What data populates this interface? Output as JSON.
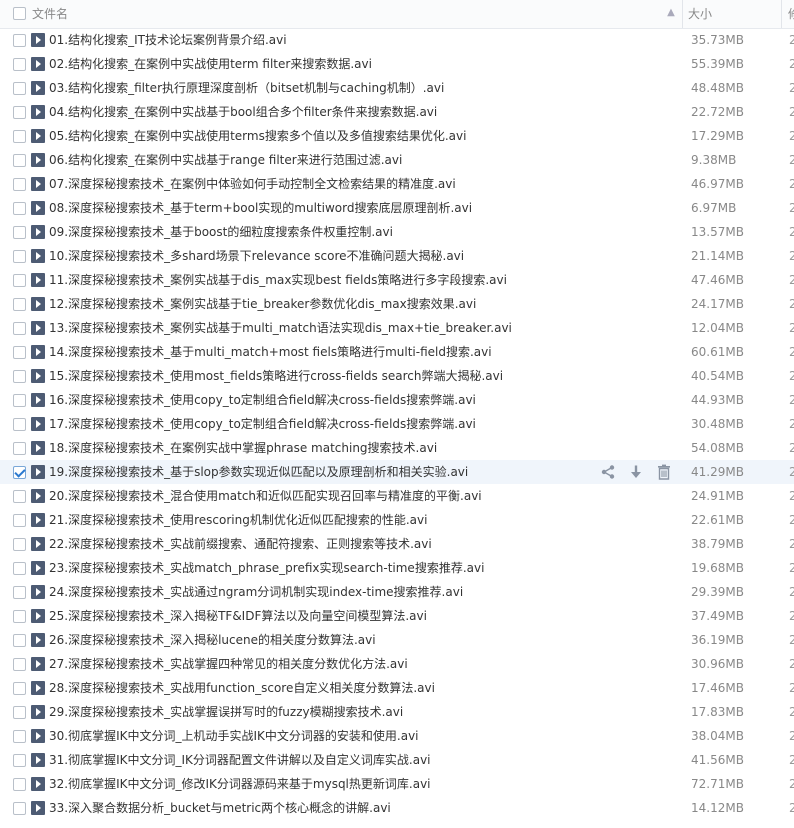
{
  "header": {
    "name_label": "文件名",
    "size_label": "大小",
    "extra_label": "修"
  },
  "icons": {
    "sort": "sort-arrow-icon",
    "file": "video-file-icon",
    "share": "share-icon",
    "download": "download-icon",
    "delete": "delete-icon"
  },
  "files": [
    {
      "name": "01.结构化搜索_IT技术论坛案例背景介绍.avi",
      "size": "35.73MB",
      "checked": false
    },
    {
      "name": "02.结构化搜索_在案例中实战使用term filter来搜索数据.avi",
      "size": "55.39MB",
      "checked": false
    },
    {
      "name": "03.结构化搜索_filter执行原理深度剖析（bitset机制与caching机制）.avi",
      "size": "48.48MB",
      "checked": false
    },
    {
      "name": "04.结构化搜索_在案例中实战基于bool组合多个filter条件来搜索数据.avi",
      "size": "22.72MB",
      "checked": false
    },
    {
      "name": "05.结构化搜索_在案例中实战使用terms搜索多个值以及多值搜索结果优化.avi",
      "size": "17.29MB",
      "checked": false
    },
    {
      "name": "06.结构化搜索_在案例中实战基于range filter来进行范围过滤.avi",
      "size": "9.38MB",
      "checked": false
    },
    {
      "name": "07.深度探秘搜索技术_在案例中体验如何手动控制全文检索结果的精准度.avi",
      "size": "46.97MB",
      "checked": false
    },
    {
      "name": "08.深度探秘搜索技术_基于term+bool实现的multiword搜索底层原理剖析.avi",
      "size": "6.97MB",
      "checked": false
    },
    {
      "name": "09.深度探秘搜索技术_基于boost的细粒度搜索条件权重控制.avi",
      "size": "13.57MB",
      "checked": false
    },
    {
      "name": "10.深度探秘搜索技术_多shard场景下relevance score不准确问题大揭秘.avi",
      "size": "21.14MB",
      "checked": false
    },
    {
      "name": "11.深度探秘搜索技术_案例实战基于dis_max实现best fields策略进行多字段搜索.avi",
      "size": "47.46MB",
      "checked": false
    },
    {
      "name": "12.深度探秘搜索技术_案例实战基于tie_breaker参数优化dis_max搜索效果.avi",
      "size": "24.17MB",
      "checked": false
    },
    {
      "name": "13.深度探秘搜索技术_案例实战基于multi_match语法实现dis_max+tie_breaker.avi",
      "size": "12.04MB",
      "checked": false
    },
    {
      "name": "14.深度探秘搜索技术_基于multi_match+most fiels策略进行multi-field搜索.avi",
      "size": "60.61MB",
      "checked": false
    },
    {
      "name": "15.深度探秘搜索技术_使用most_fields策略进行cross-fields search弊端大揭秘.avi",
      "size": "40.54MB",
      "checked": false
    },
    {
      "name": "16.深度探秘搜索技术_使用copy_to定制组合field解决cross-fields搜索弊端.avi",
      "size": "44.93MB",
      "checked": false
    },
    {
      "name": "17.深度探秘搜索技术_使用copy_to定制组合field解决cross-fields搜索弊端.avi",
      "size": "30.48MB",
      "checked": false
    },
    {
      "name": "18.深度探秘搜索技术_在案例实战中掌握phrase matching搜索技术.avi",
      "size": "54.08MB",
      "checked": false
    },
    {
      "name": "19.深度探秘搜索技术_基于slop参数实现近似匹配以及原理剖析和相关实验.avi",
      "size": "41.29MB",
      "checked": true
    },
    {
      "name": "20.深度探秘搜索技术_混合使用match和近似匹配实现召回率与精准度的平衡.avi",
      "size": "24.91MB",
      "checked": false
    },
    {
      "name": "21.深度探秘搜索技术_使用rescoring机制优化近似匹配搜索的性能.avi",
      "size": "22.61MB",
      "checked": false
    },
    {
      "name": "22.深度探秘搜索技术_实战前缀搜索、通配符搜索、正则搜索等技术.avi",
      "size": "38.79MB",
      "checked": false
    },
    {
      "name": "23.深度探秘搜索技术_实战match_phrase_prefix实现search-time搜索推荐.avi",
      "size": "19.68MB",
      "checked": false
    },
    {
      "name": "24.深度探秘搜索技术_实战通过ngram分词机制实现index-time搜索推荐.avi",
      "size": "29.39MB",
      "checked": false
    },
    {
      "name": "25.深度探秘搜索技术_深入揭秘TF&IDF算法以及向量空间模型算法.avi",
      "size": "37.49MB",
      "checked": false
    },
    {
      "name": "26.深度探秘搜索技术_深入揭秘lucene的相关度分数算法.avi",
      "size": "36.19MB",
      "checked": false
    },
    {
      "name": "27.深度探秘搜索技术_实战掌握四种常见的相关度分数优化方法.avi",
      "size": "30.96MB",
      "checked": false
    },
    {
      "name": "28.深度探秘搜索技术_实战用function_score自定义相关度分数算法.avi",
      "size": "17.46MB",
      "checked": false
    },
    {
      "name": "29.深度探秘搜索技术_实战掌握误拼写时的fuzzy模糊搜索技术.avi",
      "size": "17.83MB",
      "checked": false
    },
    {
      "name": "30.彻底掌握IK中文分词_上机动手实战IK中文分词器的安装和使用.avi",
      "size": "38.04MB",
      "checked": false
    },
    {
      "name": "31.彻底掌握IK中文分词_IK分词器配置文件讲解以及自定义词库实战.avi",
      "size": "41.56MB",
      "checked": false
    },
    {
      "name": "32.彻底掌握IK中文分词_修改IK分词器源码来基于mysql热更新词库.avi",
      "size": "72.71MB",
      "checked": false
    },
    {
      "name": "33.深入聚合数据分析_bucket与metric两个核心概念的讲解.avi",
      "size": "14.12MB",
      "checked": false
    }
  ]
}
